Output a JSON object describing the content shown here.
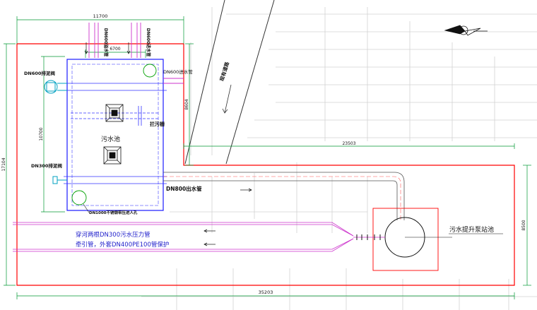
{
  "labels": {
    "dim_top": "11700",
    "dim_inner": "6700",
    "dim_left": "17104",
    "dim_mid_left": "10700",
    "dim_right_tank": "8604",
    "dim_road": "23503",
    "dim_bottom": "35203",
    "dim_right": "8500",
    "pipe_top_1": "DN600溢水管",
    "pipe_top_2": "DN600进水管",
    "pipe_inlet": "DN600进水管",
    "pipe_sludge": "DN600排泥阀",
    "pipe_drain": "DN300排泥阀",
    "tank_name": "污水池",
    "screen": "拦污栅",
    "outlet": "DN800出水管",
    "manhole": "DN1000不锈钢带压进人孔",
    "road": "现有道路",
    "pump_station": "污水提升泵站池",
    "note_line1": "穿河两根DN300污水压力管",
    "note_line2": "牵引管，外套DN400PE100管保护"
  },
  "colors": {
    "site_boundary": "#ff0000",
    "tank_wall": "#1a1aff",
    "pipe_magenta": "#cc33cc",
    "dim_green": "#009933",
    "note_blue": "#2222cc",
    "grey_lines": "#c8c8c8",
    "cyan_valve": "#00a0c0"
  },
  "icons": {
    "north_arrow": "compass-north-arrow-icon"
  }
}
